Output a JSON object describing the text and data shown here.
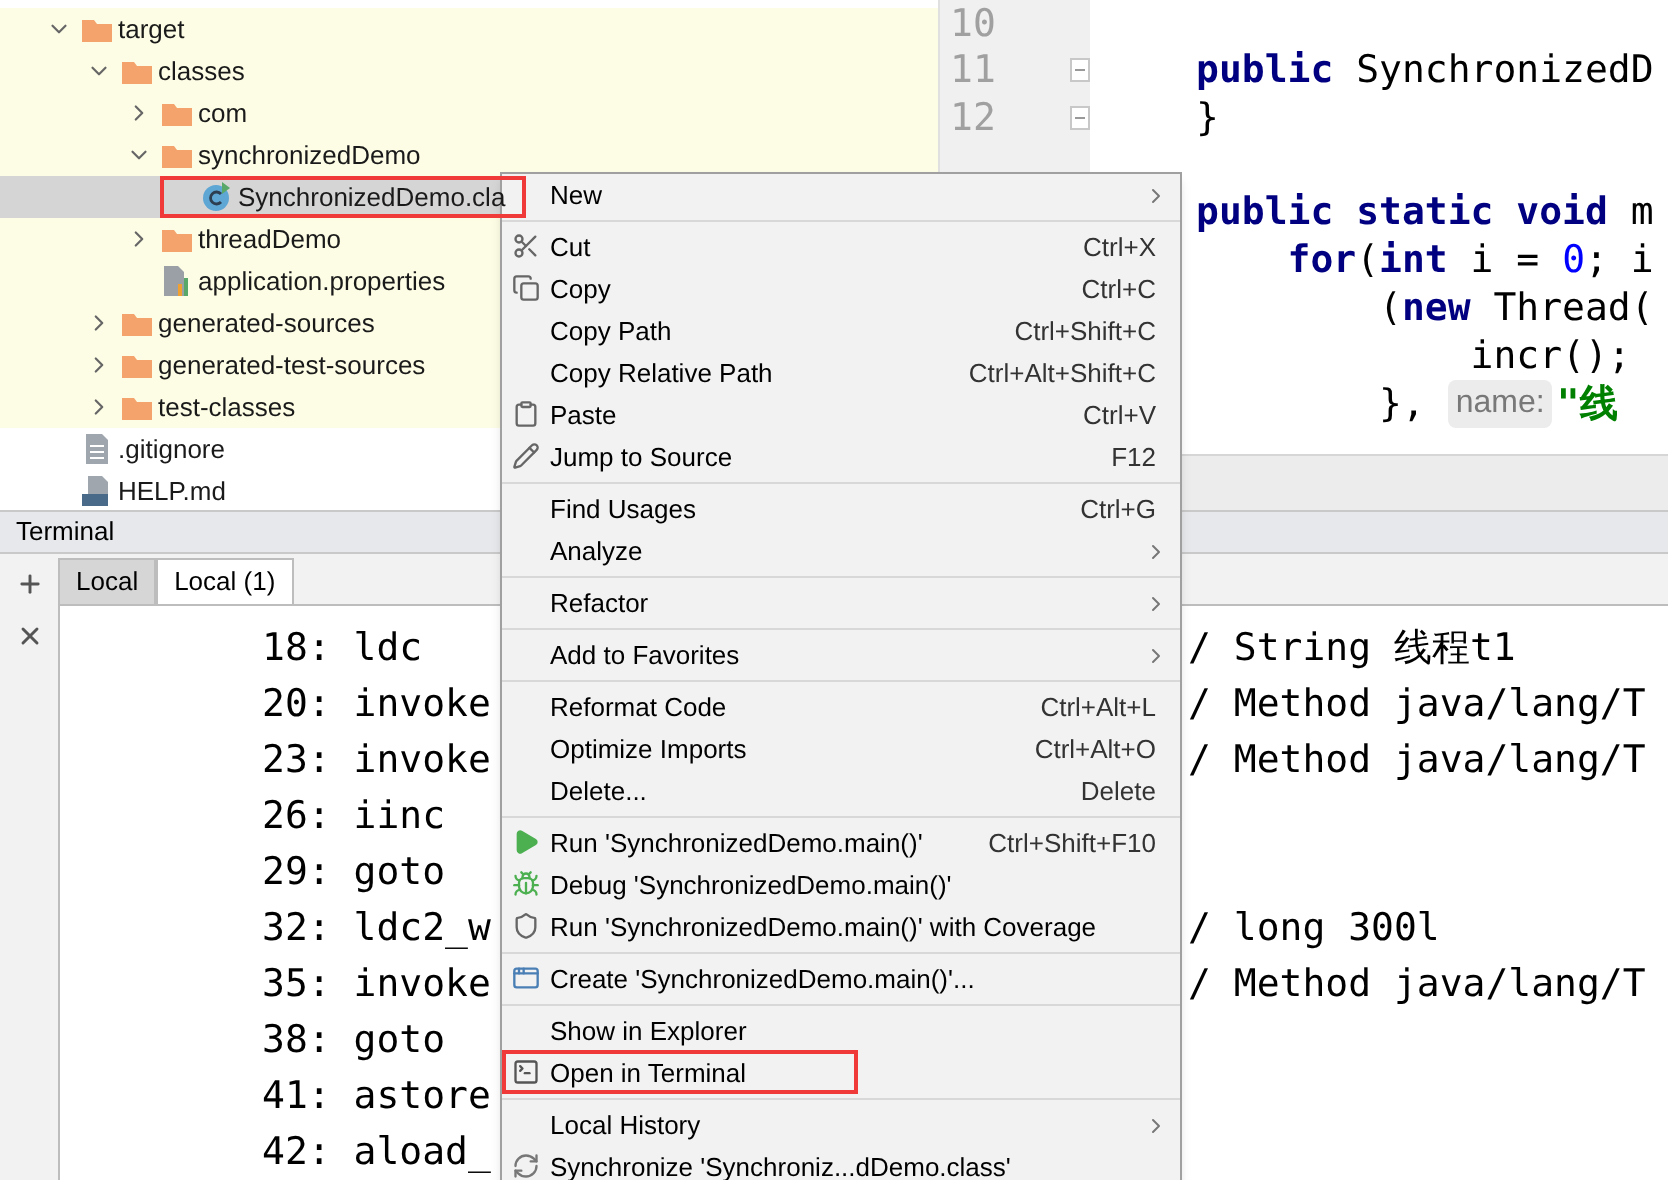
{
  "tree": {
    "items": [
      {
        "label": "target",
        "kind": "folder",
        "expanded": true,
        "excluded": true,
        "selected": false,
        "highlighted": false,
        "children": [
          {
            "label": "classes",
            "kind": "folder",
            "expanded": true,
            "selected": false,
            "highlighted": false,
            "children": [
              {
                "label": "com",
                "kind": "folder",
                "expanded": false,
                "selected": false,
                "highlighted": false
              },
              {
                "label": "synchronizedDemo",
                "kind": "folder",
                "expanded": true,
                "selected": false,
                "highlighted": false,
                "children": [
                  {
                    "label": "SynchronizedDemo.cla",
                    "kind": "class",
                    "selected": true,
                    "highlighted": true
                  }
                ]
              },
              {
                "label": "threadDemo",
                "kind": "folder",
                "expanded": false,
                "selected": false,
                "highlighted": false
              },
              {
                "label": "application.properties",
                "kind": "properties",
                "selected": false,
                "highlighted": false
              }
            ]
          },
          {
            "label": "generated-sources",
            "kind": "folder",
            "expanded": false,
            "selected": false,
            "highlighted": false
          },
          {
            "label": "generated-test-sources",
            "kind": "folder",
            "expanded": false,
            "selected": false,
            "highlighted": false
          },
          {
            "label": "test-classes",
            "kind": "folder",
            "expanded": false,
            "selected": false,
            "highlighted": false
          }
        ]
      },
      {
        "label": ".gitignore",
        "kind": "file",
        "excluded": false,
        "selected": false,
        "highlighted": false
      },
      {
        "label": "HELP.md",
        "kind": "markdown",
        "excluded": false,
        "selected": false,
        "highlighted": false
      }
    ]
  },
  "gutter": {
    "line_numbers": [
      {
        "text": "10",
        "fold": false
      },
      {
        "text": "11",
        "fold": true
      },
      {
        "text": "12",
        "fold": true
      }
    ]
  },
  "editor": {
    "lines": [
      {
        "space_before": true,
        "tokens": [
          {
            "text": "public",
            "kind": "keyword"
          },
          {
            "text": " SynchronizedD",
            "kind": "plain"
          }
        ]
      },
      {
        "tokens": [
          {
            "text": "}",
            "kind": "plain"
          }
        ]
      },
      {
        "space_before": true,
        "tokens": [
          {
            "text": "public static void",
            "kind": "keyword"
          },
          {
            "text": " m",
            "kind": "plain"
          }
        ]
      },
      {
        "tokens": [
          {
            "text": "    for",
            "kind": "keyword"
          },
          {
            "text": "(",
            "kind": "plain"
          },
          {
            "text": "int",
            "kind": "keyword"
          },
          {
            "text": " i = ",
            "kind": "plain"
          },
          {
            "text": "0",
            "kind": "number"
          },
          {
            "text": "; i",
            "kind": "plain"
          }
        ]
      },
      {
        "tokens": [
          {
            "text": "        (",
            "kind": "plain"
          },
          {
            "text": "new",
            "kind": "keyword"
          },
          {
            "text": " Thread(",
            "kind": "plain"
          }
        ]
      },
      {
        "tokens": [
          {
            "text": "            incr();",
            "kind": "plain"
          }
        ]
      },
      {
        "tokens": [
          {
            "text": "        }, ",
            "kind": "plain"
          },
          {
            "text": "name:",
            "kind": "hint"
          },
          {
            "text": "\"线",
            "kind": "string"
          }
        ]
      }
    ]
  },
  "terminal": {
    "title": "Terminal",
    "tabs": [
      {
        "label": "Local",
        "selected": false
      },
      {
        "label": "Local (1)",
        "selected": true
      }
    ],
    "lines": [
      {
        "left": "18: ldc",
        "right": "/ String 线程t1"
      },
      {
        "left": "20: invoke",
        "right": "/ Method java/lang/T"
      },
      {
        "left": "23: invoke",
        "right": "/ Method java/lang/T"
      },
      {
        "left": "26: iinc"
      },
      {
        "left": "29: goto"
      },
      {
        "left": "32: ldc2_w",
        "right": "/ long 300l"
      },
      {
        "left": "35: invoke",
        "right": "/ Method java/lang/T"
      },
      {
        "left": "38: goto"
      },
      {
        "left": "41: astore"
      },
      {
        "left": "42: aload_"
      }
    ]
  },
  "menu": {
    "groups": [
      {
        "items": [
          {
            "label": "New",
            "submenu": true,
            "highlighted": false
          }
        ]
      },
      {
        "items": [
          {
            "label": "Cut",
            "shortcut": "Ctrl+X",
            "submenu": false,
            "highlighted": false
          },
          {
            "label": "Copy",
            "shortcut": "Ctrl+C",
            "submenu": false,
            "highlighted": false
          },
          {
            "label": "Copy Path",
            "shortcut": "Ctrl+Shift+C",
            "submenu": false,
            "highlighted": false
          },
          {
            "label": "Copy Relative Path",
            "shortcut": "Ctrl+Alt+Shift+C",
            "submenu": false,
            "highlighted": false
          },
          {
            "label": "Paste",
            "shortcut": "Ctrl+V",
            "submenu": false,
            "highlighted": false
          },
          {
            "label": "Jump to Source",
            "shortcut": "F12",
            "submenu": false,
            "highlighted": false
          }
        ]
      },
      {
        "items": [
          {
            "label": "Find Usages",
            "shortcut": "Ctrl+G",
            "submenu": false,
            "highlighted": false
          },
          {
            "label": "Analyze",
            "submenu": true,
            "highlighted": false
          }
        ]
      },
      {
        "items": [
          {
            "label": "Refactor",
            "submenu": true,
            "highlighted": false
          }
        ]
      },
      {
        "items": [
          {
            "label": "Add to Favorites",
            "submenu": true,
            "highlighted": false
          }
        ]
      },
      {
        "items": [
          {
            "label": "Reformat Code",
            "shortcut": "Ctrl+Alt+L",
            "submenu": false,
            "highlighted": false
          },
          {
            "label": "Optimize Imports",
            "shortcut": "Ctrl+Alt+O",
            "submenu": false,
            "highlighted": false
          },
          {
            "label": "Delete...",
            "shortcut": "Delete",
            "submenu": false,
            "highlighted": false
          }
        ]
      },
      {
        "items": [
          {
            "label": "Run 'SynchronizedDemo.main()'",
            "shortcut": "Ctrl+Shift+F10",
            "submenu": false,
            "highlighted": false
          },
          {
            "label": "Debug 'SynchronizedDemo.main()'",
            "submenu": false,
            "highlighted": false
          },
          {
            "label": "Run 'SynchronizedDemo.main()' with Coverage",
            "submenu": false,
            "highlighted": false
          }
        ]
      },
      {
        "items": [
          {
            "label": "Create 'SynchronizedDemo.main()'...",
            "submenu": false,
            "highlighted": false
          }
        ]
      },
      {
        "items": [
          {
            "label": "Show in Explorer",
            "submenu": false,
            "highlighted": false
          },
          {
            "label": "Open in Terminal",
            "submenu": false,
            "highlighted": true
          }
        ]
      },
      {
        "items": [
          {
            "label": "Local History",
            "submenu": true,
            "highlighted": false
          },
          {
            "label": "Synchronize 'Synchroniz...dDemo.class'",
            "submenu": false,
            "highlighted": false
          }
        ]
      }
    ]
  }
}
